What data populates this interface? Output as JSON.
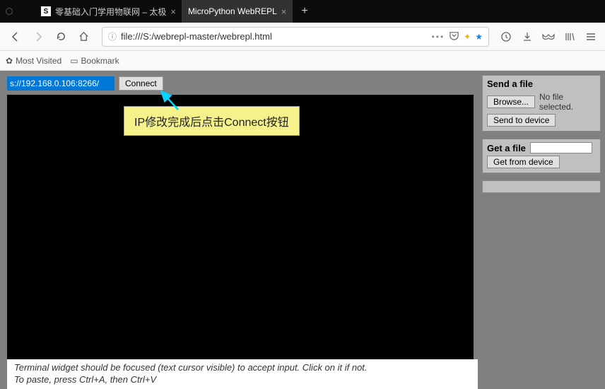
{
  "tabs": {
    "inactive_label": "零基础入门学用物联网 – 太极",
    "active_label": "MicroPython WebREPL"
  },
  "url": "file:///S:/webrepl-master/webrepl.html",
  "bookmarks": {
    "most_visited": "Most Visited",
    "bookmark": "Bookmark"
  },
  "ip_value": "s://192.168.0.106:8266/",
  "connect_label": "Connect",
  "annotation": "IP修改完成后点击Connect按钮",
  "hints": {
    "line1": "Terminal widget should be focused (text cursor visible) to accept input. Click on it if not.",
    "line2": "To paste, press Ctrl+A, then Ctrl+V"
  },
  "sidebar": {
    "send_title": "Send a file",
    "browse_label": "Browse...",
    "no_file": "No file selected.",
    "send_btn": "Send to device",
    "get_title": "Get a file",
    "get_btn": "Get from device"
  }
}
